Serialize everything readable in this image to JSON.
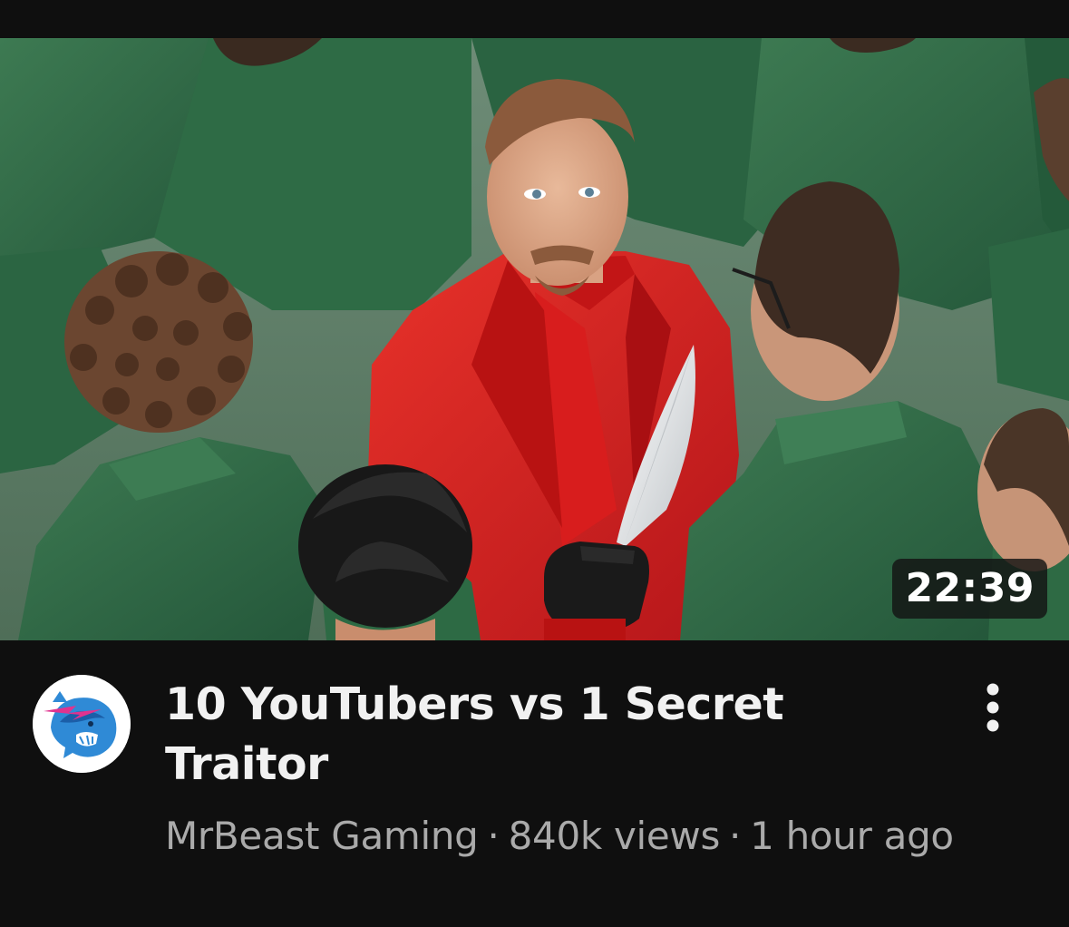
{
  "video": {
    "title": "10 YouTubers vs 1 Secret Traitor",
    "duration": "22:39",
    "channel": "MrBeast Gaming",
    "separator": "·",
    "views": "840k views",
    "age": "1 hour ago"
  },
  "icons": {
    "avatar": "mrbeast-gaming-panther-logo",
    "menu": "more-vertical-icon"
  },
  "colors": {
    "background": "#0f0f0f",
    "title": "#f1f1f1",
    "meta": "#aaaaaa",
    "duration_badge": "#141414",
    "suit_green": "#2f6a45",
    "suit_red": "#d4201f",
    "logo_blue": "#2f8ad6",
    "logo_pink": "#e0338f"
  }
}
